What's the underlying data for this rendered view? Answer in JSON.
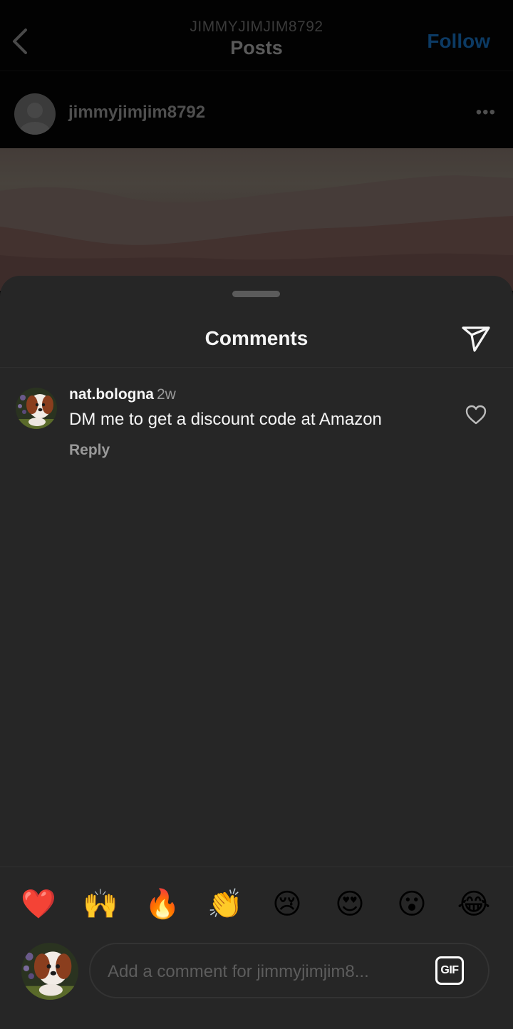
{
  "header": {
    "subtitle": "JIMMYJIMJIM8792",
    "title": "Posts",
    "follow_label": "Follow",
    "icons": {
      "back": "chevron-left-icon"
    },
    "accent_color": "#0095f6"
  },
  "post": {
    "username": "jimmyjimjim8792",
    "more_label": "•••",
    "image": "mountain-landscape"
  },
  "comments_sheet": {
    "title": "Comments",
    "share_icon": "paper-plane-icon",
    "comments": [
      {
        "username": "nat.bologna",
        "time": "2w",
        "text": "DM me to get a discount code at Amazon",
        "reply_label": "Reply",
        "avatar": "puppy-photo"
      }
    ],
    "quick_reactions": [
      "❤️",
      "🙌",
      "🔥",
      "👏",
      "😢",
      "😍",
      "😮",
      "😂"
    ],
    "composer": {
      "placeholder": "Add a comment for jimmyjimjim8...",
      "value": "",
      "gif_label": "GIF"
    }
  }
}
